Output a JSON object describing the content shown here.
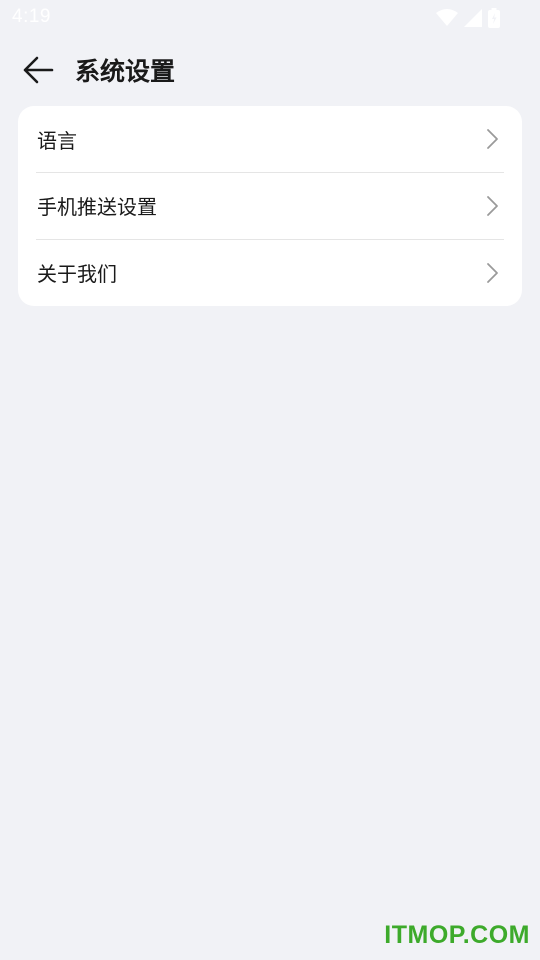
{
  "status_bar": {
    "time": "4:19",
    "icons": [
      "wifi-icon",
      "signal-icon",
      "battery-icon"
    ]
  },
  "header": {
    "back_icon": "arrow-left-icon",
    "title": "系统设置"
  },
  "settings": {
    "items": [
      {
        "label": "语言",
        "icon": "chevron-right-icon"
      },
      {
        "label": "手机推送设置",
        "icon": "chevron-right-icon"
      },
      {
        "label": "关于我们",
        "icon": "chevron-right-icon"
      }
    ]
  },
  "watermark": {
    "text": "ITMOP.COM",
    "color": "#3daa2b"
  },
  "colors": {
    "background": "#f1f2f6",
    "card": "#ffffff",
    "text": "#1a1a1a",
    "chevron": "#9a9a9a"
  }
}
